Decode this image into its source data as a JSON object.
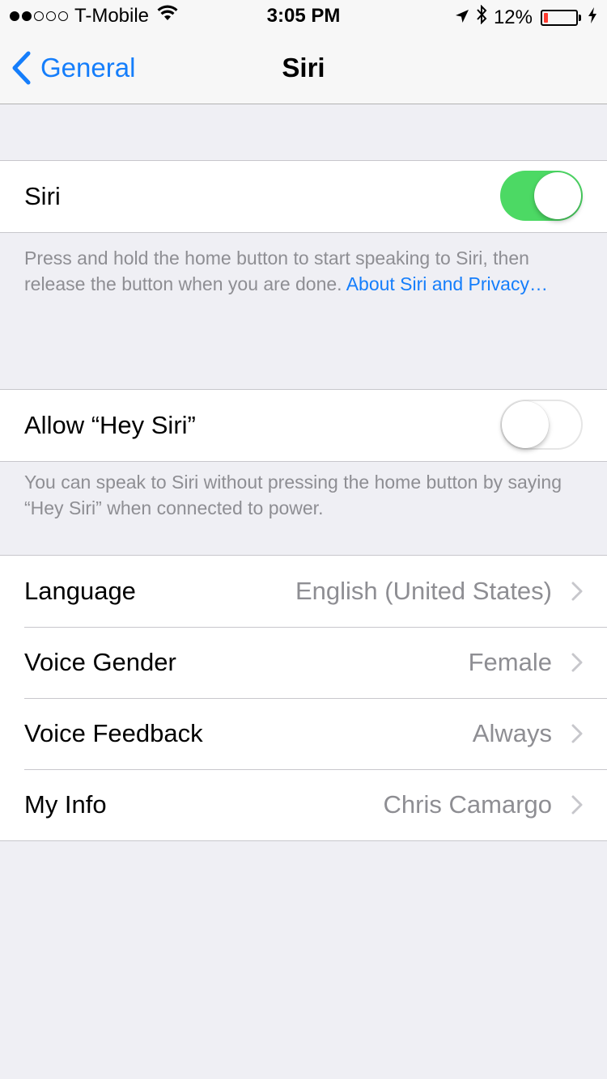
{
  "status_bar": {
    "signal_dots_filled": 2,
    "signal_dots_total": 5,
    "carrier": "T-Mobile",
    "time": "3:05 PM",
    "battery_percent": "12%",
    "battery_level": 0.12
  },
  "nav": {
    "back_label": "General",
    "title": "Siri"
  },
  "siri_section": {
    "label": "Siri",
    "enabled": true,
    "footer_text": "Press and hold the home button to start speaking to Siri, then release the button when you are done. ",
    "footer_link": "About Siri and Privacy…"
  },
  "hey_siri_section": {
    "label": "Allow “Hey Siri”",
    "enabled": false,
    "footer_text": "You can speak to Siri without pressing the home button by saying “Hey Siri” when connected to power."
  },
  "settings": [
    {
      "label": "Language",
      "value": "English (United States)"
    },
    {
      "label": "Voice Gender",
      "value": "Female"
    },
    {
      "label": "Voice Feedback",
      "value": "Always"
    },
    {
      "label": "My Info",
      "value": "Chris Camargo"
    }
  ],
  "colors": {
    "accent": "#157efb",
    "switch_on": "#4cd964",
    "battery_low": "#ff3b30",
    "background": "#efeff4"
  }
}
